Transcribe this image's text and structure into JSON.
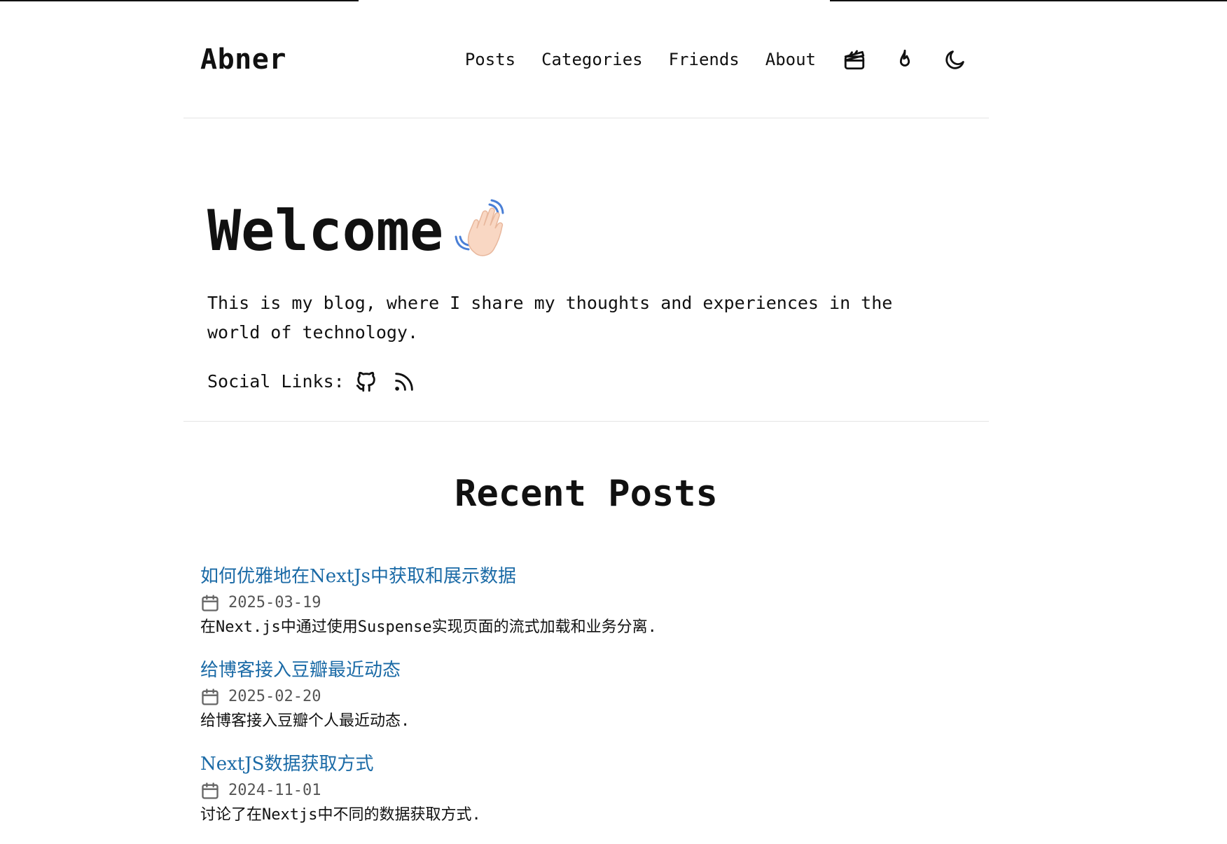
{
  "site": {
    "logo": "Abner"
  },
  "nav": {
    "links": [
      "Posts",
      "Categories",
      "Friends",
      "About"
    ],
    "icons": [
      "clapperboard-icon",
      "flame-icon",
      "moon-icon"
    ]
  },
  "hero": {
    "title": "Welcome",
    "emoji_icon": "waving-hand-icon",
    "description": "This is my blog, where I share my thoughts and experiences in the world of technology.",
    "social_label": "Social Links:",
    "social_icons": [
      "github-icon",
      "rss-icon"
    ]
  },
  "recent": {
    "heading": "Recent Posts",
    "posts": [
      {
        "title": "如何优雅地在NextJs中获取和展示数据",
        "date": "2025-03-19",
        "summary": "在Next.js中通过使用Suspense实现页面的流式加载和业务分离."
      },
      {
        "title": "给博客接入豆瓣最近动态",
        "date": "2025-02-20",
        "summary": "给博客接入豆瓣个人最近动态."
      },
      {
        "title": "NextJS数据获取方式",
        "date": "2024-11-01",
        "summary": "讨论了在Nextjs中不同的数据获取方式."
      }
    ]
  },
  "colors": {
    "link": "#1a6aa6",
    "text": "#111111",
    "muted": "#555555",
    "divider": "#e5e5e5"
  }
}
